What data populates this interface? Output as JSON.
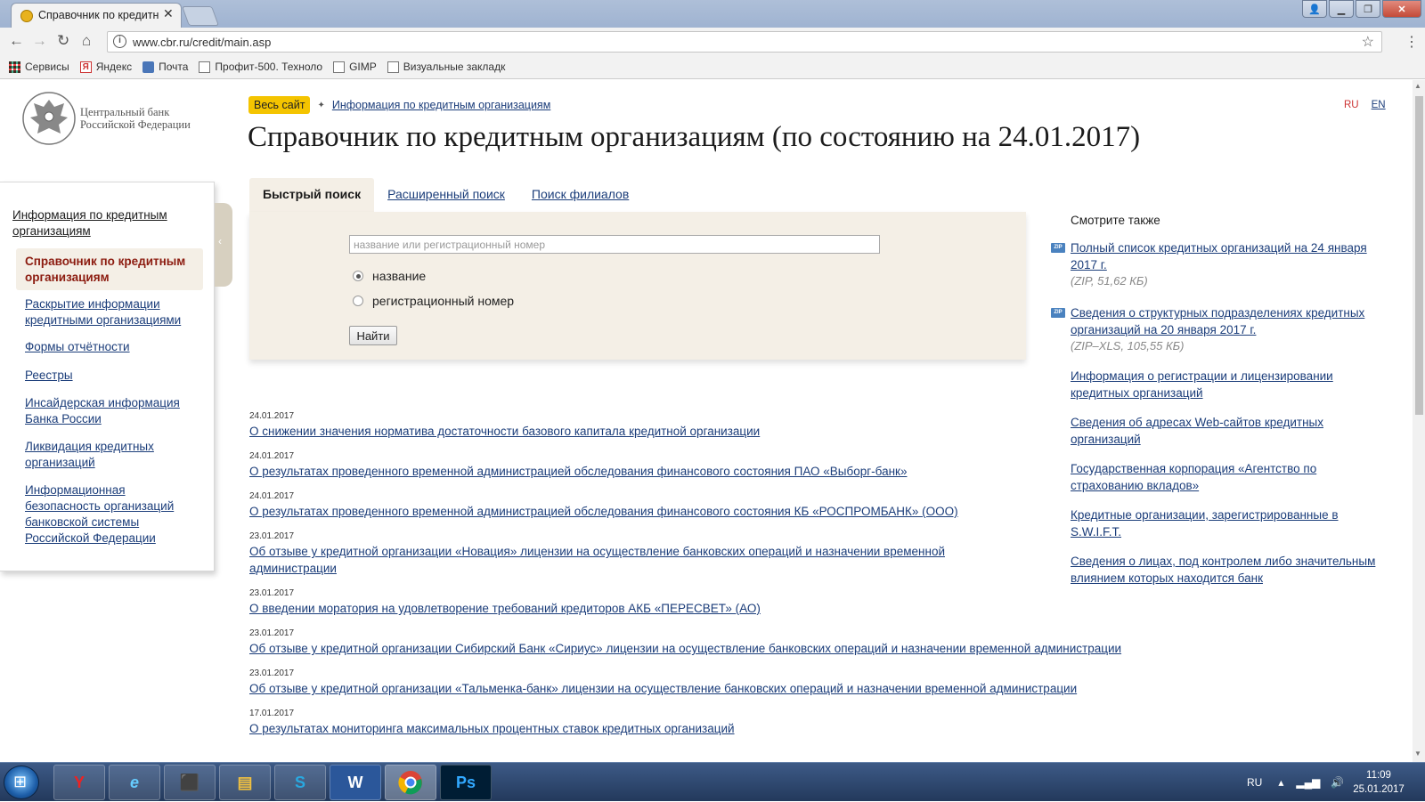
{
  "browser": {
    "tab_title": "Справочник по кредитн",
    "url": "www.cbr.ru/credit/main.asp",
    "bookmarks": [
      "Сервисы",
      "Яндекс",
      "Почта",
      "Профит-500. Техноло",
      "GIMP",
      "Визуальные закладк"
    ]
  },
  "header": {
    "logo_line1": "Центральный банк",
    "logo_line2": "Российской Федерации",
    "crumb_all": "Весь сайт",
    "crumb_link": "Информация по кредитным организациям",
    "lang_ru": "RU",
    "lang_en": "EN",
    "title": "Справочник по кредитным организациям (по состоянию на 24.01.2017)"
  },
  "sidebar": {
    "heading": "Информация по кредитным организациям",
    "active": "Справочник по кредитным организациям",
    "items": [
      "Раскрытие информации кредитными организациями",
      "Формы отчётности",
      "Реестры",
      "Инсайдерская информация Банка России",
      "Ликвидация кредитных организаций",
      "Информационная безопасность организаций банковской системы Российской Федерации"
    ]
  },
  "tabs": [
    "Быстрый поиск",
    "Расширенный поиск",
    "Поиск филиалов"
  ],
  "search": {
    "placeholder": "название или регистрационный номер",
    "radio_name": "название",
    "radio_reg": "регистрационный номер",
    "button": "Найти"
  },
  "news": [
    {
      "date": "24.01.2017",
      "title": "О снижении значения норматива достаточности базового капитала кредитной организации"
    },
    {
      "date": "24.01.2017",
      "title": "О результатах проведенного временной администрацией обследования финансового состояния ПАО «Выборг-банк»"
    },
    {
      "date": "24.01.2017",
      "title": "О результатах проведенного временной администрацией обследования финансового состояния КБ «РОСПРОМБАНК» (ООО)"
    },
    {
      "date": "23.01.2017",
      "title": "Об отзыве у кредитной организации «Новация» лицензии на осуществление банковских операций и назначении временной администрации"
    },
    {
      "date": "23.01.2017",
      "title": "О введении моратория на удовлетворение требований кредиторов АКБ «ПЕРЕСВЕТ» (АО)"
    },
    {
      "date": "23.01.2017",
      "title": "Об отзыве у кредитной организации Сибирский Банк «Сириус» лицензии на осуществление банковских операций и назначении временной администрации"
    },
    {
      "date": "23.01.2017",
      "title": "Об отзыве у кредитной организации «Тальменка-банк» лицензии на осуществление банковских операций и назначении временной администрации"
    },
    {
      "date": "17.01.2017",
      "title": "О результатах мониторинга максимальных процентных ставок кредитных организаций"
    }
  ],
  "see_also": {
    "title": "Смотрите также",
    "zip_label": "ZIP",
    "items": [
      {
        "text": "Полный список кредитных организаций на 24 января 2017 г.",
        "meta": "(ZIP, 51,62 КБ)"
      },
      {
        "text": "Сведения о структурных подразделениях кредитных организаций на 20 января 2017 г.",
        "meta": "(ZIP–XLS, 105,55 КБ)"
      },
      {
        "text": "Информация о регистрации и лицензировании кредитных организаций"
      },
      {
        "text": "Сведения об адресах Web-сайтов кредитных организаций"
      },
      {
        "text": "Государственная корпорация «Агентство по страхованию вкладов»"
      },
      {
        "text": "Кредитные организации, зарегистрированные в S.W.I.F.T."
      },
      {
        "text": "Сведения о лицах, под контролем либо значительным влиянием которых находится банк"
      }
    ]
  },
  "taskbar": {
    "lang": "RU",
    "time": "11:09",
    "date": "25.01.2017",
    "apps": [
      "Яндекс",
      "Internet Explorer",
      "Acrobat",
      "Проводник",
      "Skype",
      "Word",
      "Chrome",
      "Photoshop"
    ]
  },
  "colors": {
    "link": "#1b3d7a",
    "active_text": "#8c1c10",
    "panel_bg": "#f4efe6",
    "crumb_badge": "#f4c400"
  }
}
